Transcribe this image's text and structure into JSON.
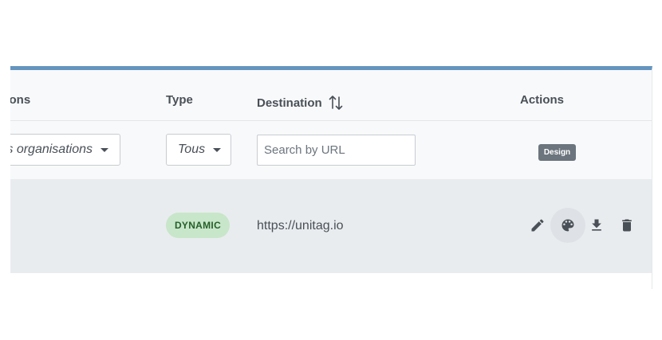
{
  "table": {
    "columns": {
      "organisations": "ations",
      "type": "Type",
      "destination": "Destination",
      "actions": "Actions"
    },
    "filters": {
      "organisation_value": "s organisations",
      "type_value": "Tous",
      "search_placeholder": "Search by URL",
      "search_value": ""
    },
    "rows": [
      {
        "type_badge": "DYNAMIC",
        "destination": "https://unitag.io",
        "actions": [
          "pencil-icon",
          "palette-icon",
          "download-icon",
          "trash-icon"
        ]
      }
    ],
    "tooltip": "Design"
  },
  "colors": {
    "accent_border": "#6495bf",
    "badge_bg": "#c8e6c9",
    "badge_text": "#256029",
    "row_bg": "#e9ecef",
    "header_bg": "#f8f9fa",
    "tooltip_bg": "#6c757d"
  }
}
